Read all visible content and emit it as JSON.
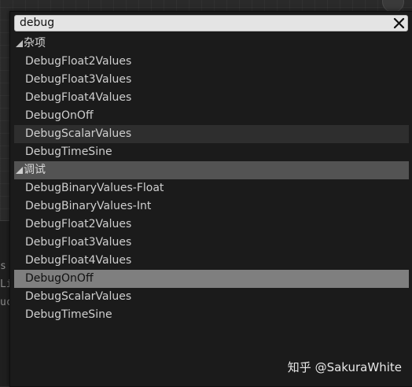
{
  "search": {
    "value": "debug",
    "clear_icon": "close-icon"
  },
  "background": {
    "left_text": [
      "s",
      "Li",
      "uc"
    ]
  },
  "categories": [
    {
      "label": "杂项",
      "expanded": true,
      "items": [
        "DebugFloat2Values",
        "DebugFloat3Values",
        "DebugFloat4Values",
        "DebugOnOff",
        "DebugScalarValues",
        "DebugTimeSine"
      ]
    },
    {
      "label": "调试",
      "expanded": true,
      "items": [
        "DebugBinaryValues-Float",
        "DebugBinaryValues-Int",
        "DebugFloat2Values",
        "DebugFloat3Values",
        "DebugFloat4Values",
        "DebugOnOff",
        "DebugScalarValues",
        "DebugTimeSine"
      ]
    }
  ],
  "watermark": "知乎 @SakuraWhite",
  "colors": {
    "menu_bg": "#1b1b1b",
    "selected_row": "#7f7f7f",
    "category_highlight": "#535353",
    "hover_row": "#2e2e2e"
  }
}
